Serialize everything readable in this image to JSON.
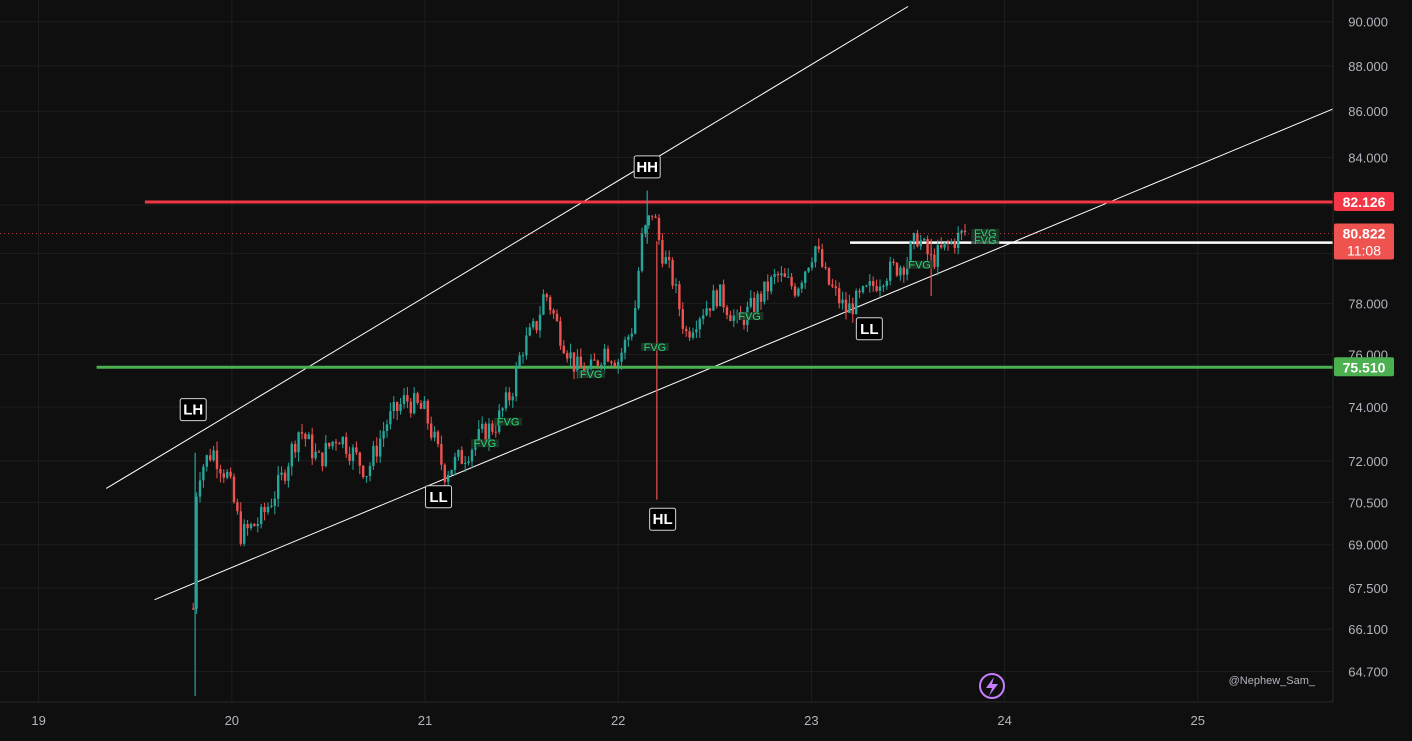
{
  "colors": {
    "background": "#0f0f0f",
    "grid": "#1e1e1e",
    "up": "#26a69a",
    "down": "#ef5350",
    "resistance": "#f23645",
    "support": "#4caf50",
    "white": "#ffffff",
    "fvg": "#2ed573",
    "axis_text": "#b2b5be"
  },
  "chart_data": {
    "type": "candlestick",
    "x_ticks": [
      "19",
      "20",
      "21",
      "22",
      "23",
      "24",
      "25"
    ],
    "y_ticks": [
      "64.700",
      "66.100",
      "67.500",
      "69.000",
      "70.500",
      "72.000",
      "74.000",
      "76.000",
      "78.000",
      "80.000",
      "82.000",
      "84.000",
      "86.000",
      "88.000",
      "90.000"
    ],
    "xlim": [
      18.8,
      25.7
    ],
    "ylim": [
      63.7,
      91.0
    ],
    "log_scale": true,
    "grid": true,
    "horizontal_levels": [
      {
        "name": "resistance",
        "value": 82.126,
        "label": "82.126",
        "color": "#f23645"
      },
      {
        "name": "support",
        "value": 75.51,
        "label": "75.510",
        "color": "#4caf50"
      },
      {
        "name": "mid",
        "value": 80.445,
        "label": "80.445",
        "color": "#ffffff"
      }
    ],
    "current_price": {
      "value": 80.822,
      "label": "80.822",
      "countdown": "11:08"
    },
    "channel": {
      "upper": [
        [
          19.35,
          71.0
        ],
        [
          23.5,
          90.7
        ]
      ],
      "lower": [
        [
          19.6,
          67.1
        ],
        [
          25.7,
          86.1
        ]
      ]
    },
    "structure_labels": [
      {
        "text": "LH",
        "x": 19.8,
        "y": 73.9
      },
      {
        "text": "LL",
        "x": 21.07,
        "y": 70.7
      },
      {
        "text": "HH",
        "x": 22.15,
        "y": 83.6
      },
      {
        "text": "HL",
        "x": 22.23,
        "y": 69.9
      },
      {
        "text": "LL",
        "x": 23.3,
        "y": 77.0
      }
    ],
    "fvg_labels": [
      {
        "text": "FVG",
        "x": 21.31,
        "y": 72.65
      },
      {
        "text": "FVG",
        "x": 21.43,
        "y": 73.45
      },
      {
        "text": "FVG",
        "x": 21.86,
        "y": 75.25
      },
      {
        "text": "FVG",
        "x": 22.19,
        "y": 76.3
      },
      {
        "text": "FVG",
        "x": 22.68,
        "y": 77.5
      },
      {
        "text": "FVG",
        "x": 23.56,
        "y": 79.55
      },
      {
        "text": "FVG",
        "x": 23.9,
        "y": 80.85
      },
      {
        "text": "FVG",
        "x": 23.9,
        "y": 80.55
      }
    ],
    "price_path": [
      [
        19.8,
        66.8
      ],
      [
        19.82,
        71.5
      ],
      [
        19.9,
        72.4
      ],
      [
        19.98,
        71.4
      ],
      [
        20.05,
        69.3
      ],
      [
        20.15,
        69.9
      ],
      [
        20.25,
        71.2
      ],
      [
        20.35,
        73.2
      ],
      [
        20.45,
        72.0
      ],
      [
        20.55,
        73.0
      ],
      [
        20.7,
        71.6
      ],
      [
        20.8,
        73.4
      ],
      [
        20.9,
        74.3
      ],
      [
        21.0,
        73.8
      ],
      [
        21.1,
        71.6
      ],
      [
        21.2,
        72.2
      ],
      [
        21.3,
        73.0
      ],
      [
        21.37,
        73.4
      ],
      [
        21.45,
        74.6
      ],
      [
        21.5,
        76.2
      ],
      [
        21.58,
        77.2
      ],
      [
        21.62,
        78.5
      ],
      [
        21.7,
        76.8
      ],
      [
        21.78,
        75.5
      ],
      [
        21.85,
        75.3
      ],
      [
        21.93,
        76.2
      ],
      [
        22.0,
        75.8
      ],
      [
        22.08,
        77.2
      ],
      [
        22.12,
        80.5
      ],
      [
        22.18,
        81.8
      ],
      [
        22.22,
        80.2
      ],
      [
        22.28,
        79.0
      ],
      [
        22.35,
        76.8
      ],
      [
        22.42,
        77.6
      ],
      [
        22.52,
        78.4
      ],
      [
        22.62,
        77.2
      ],
      [
        22.72,
        78.1
      ],
      [
        22.82,
        79.1
      ],
      [
        22.92,
        78.6
      ],
      [
        23.02,
        80.3
      ],
      [
        23.08,
        78.9
      ],
      [
        23.18,
        77.7
      ],
      [
        23.28,
        78.4
      ],
      [
        23.38,
        79.2
      ],
      [
        23.48,
        79.6
      ],
      [
        23.55,
        80.7
      ],
      [
        23.62,
        79.7
      ],
      [
        23.7,
        80.3
      ],
      [
        23.8,
        80.9
      ]
    ]
  },
  "watermark": "@Nephew_Sam_",
  "flash_icon": "lightning-icon"
}
